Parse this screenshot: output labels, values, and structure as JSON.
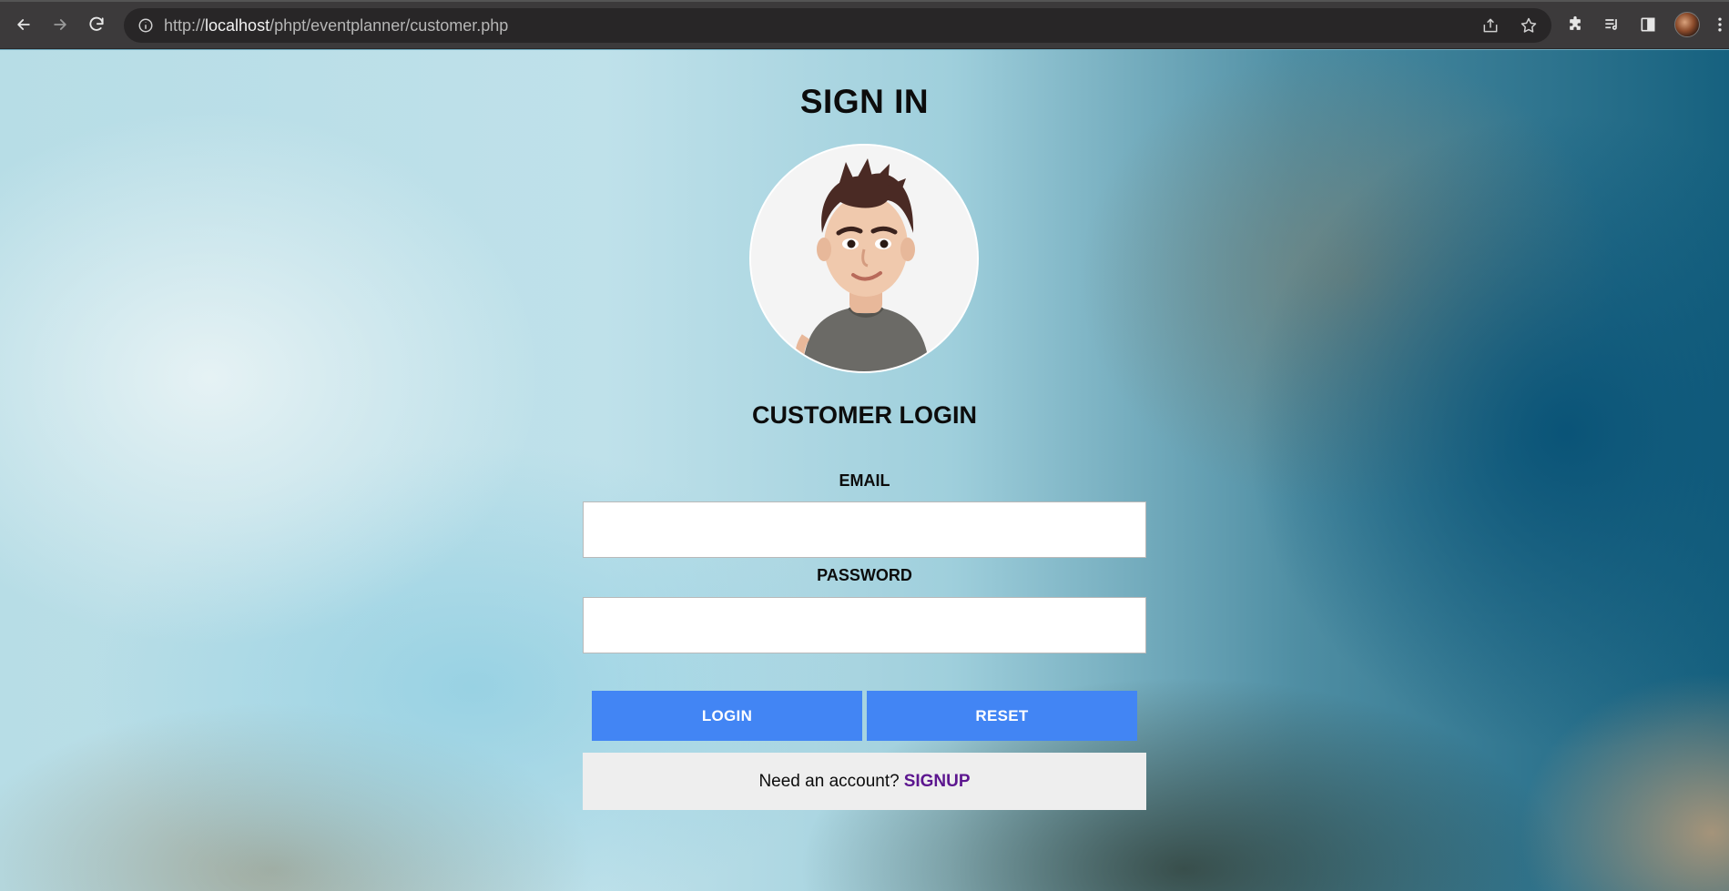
{
  "browser": {
    "url_prefix": "http://",
    "url_host": "localhost",
    "url_path": "/phpt/eventplanner/customer.php"
  },
  "page": {
    "title": "SIGN IN",
    "subtitle": "CUSTOMER LOGIN",
    "email_label": "EMAIL",
    "password_label": "PASSWORD",
    "email_value": "",
    "password_value": "",
    "login_label": "LOGIN",
    "reset_label": "RESET",
    "signup_prompt": "Need an account?",
    "signup_link": "SIGNUP"
  },
  "colors": {
    "button": "#4285f4",
    "signup_link": "#5c168f"
  }
}
